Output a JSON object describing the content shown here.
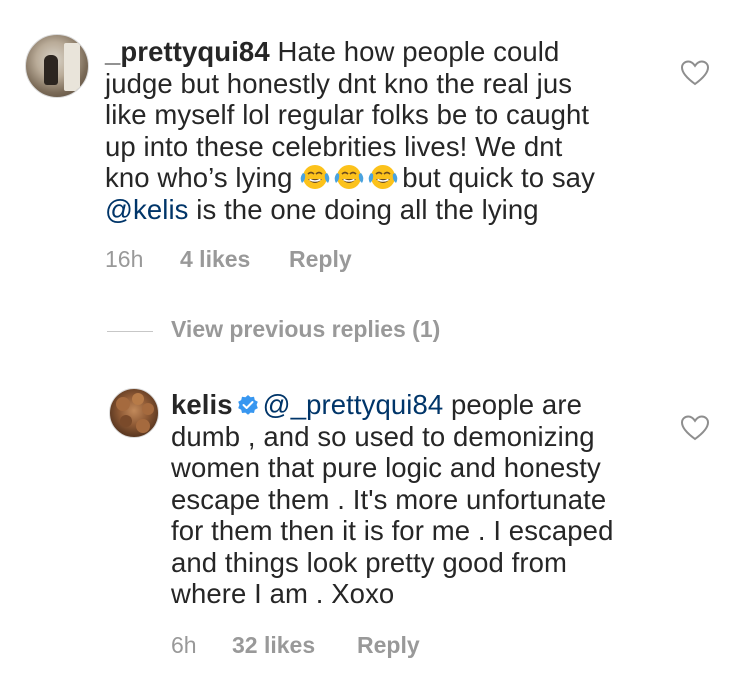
{
  "comments": [
    {
      "username": "_prettyqui84",
      "lines": [
        "Hate how people could",
        "judge but honestly dnt kno the real jus",
        "like myself lol regular folks be to caught",
        "up into these celebrities lives! We dnt",
        "kno who’s lying",
        "but quick to say",
        "@kelis",
        " is the one doing all the lying"
      ],
      "emoji": "face-with-tears-of-joy",
      "time": "16h",
      "likes": "4 likes",
      "reply": "Reply"
    },
    {
      "username": "kelis",
      "mention": "@_prettyqui84",
      "lines": [
        "people are",
        "dumb , and so used to demonizing",
        "women that pure logic and honesty",
        "escape them . It's more unfortunate",
        "for them then it is for me . I escaped",
        "and things look pretty good from",
        "where I am . Xoxo"
      ],
      "time": "6h",
      "likes": "32 likes",
      "reply": "Reply"
    }
  ],
  "view_previous": "View previous replies (1)",
  "colors": {
    "text": "#262626",
    "meta": "#999999",
    "mention": "#003569",
    "verified": "#3897f0",
    "heart": "#8e8e8e"
  },
  "icons": [
    "heart-icon",
    "verified-badge-icon",
    "face-with-tears-of-joy"
  ]
}
